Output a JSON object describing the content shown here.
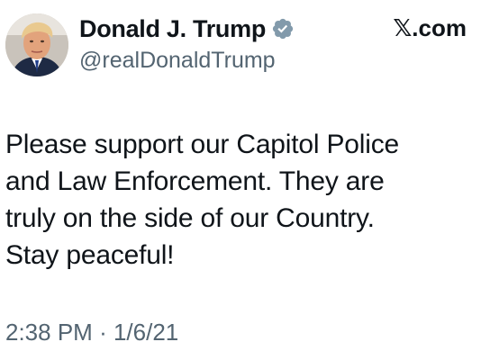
{
  "author": {
    "display_name": "Donald J. Trump",
    "handle": "@realDonaldTrump",
    "verified": true,
    "verified_color": "#829aab"
  },
  "source": {
    "label": "𝕏.com"
  },
  "tweet": {
    "lines": [
      "Please support our Capitol Police",
      "and Law Enforcement. They are",
      "truly on the side of our Country.",
      "Stay peaceful!"
    ],
    "time": "2:38 PM",
    "separator": "·",
    "date": "1/6/21"
  },
  "colors": {
    "text": "#0f1419",
    "secondary_text": "#536471",
    "background": "#ffffff"
  }
}
